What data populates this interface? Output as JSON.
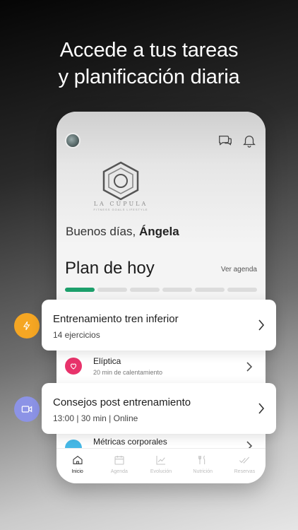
{
  "headline": {
    "line1": "Accede a tus tareas",
    "line2": "y planificación diaria"
  },
  "app": {
    "brand": {
      "name": "LA CÚPULA",
      "tagline": "FITNESS GOALS LIFESTYLE"
    },
    "greeting": {
      "prefix": "Buenos días,",
      "name": "Ángela"
    },
    "plan": {
      "title": "Plan de hoy",
      "agenda_link": "Ver agenda",
      "progress": {
        "completed": 1,
        "total": 6
      }
    },
    "rows": [
      {
        "title": "Elíptica",
        "subtitle": "20 min de calentamiento",
        "icon": "heart-icon",
        "color": "#e8336b"
      },
      {
        "title": "Métricas corporales",
        "icon": "scale-icon",
        "color": "#46b8e6"
      }
    ],
    "nav": [
      {
        "label": "Inicio",
        "icon": "home-icon",
        "active": true
      },
      {
        "label": "Agenda",
        "icon": "calendar-icon",
        "active": false
      },
      {
        "label": "Evolución",
        "icon": "chart-icon",
        "active": false
      },
      {
        "label": "Nutrición",
        "icon": "utensils-icon",
        "active": false
      },
      {
        "label": "Reservas",
        "icon": "checks-icon",
        "active": false
      }
    ]
  },
  "cards": [
    {
      "title": "Entrenamiento tren inferior",
      "subtitle": "14 ejercicios",
      "badge_icon": "lightning-icon",
      "badge_color": "#f5a623"
    },
    {
      "title": "Consejos post entrenamiento",
      "subtitle": "13:00 | 30 min | Online",
      "badge_icon": "video-icon",
      "badge_color": "#8c93e6"
    }
  ],
  "colors": {
    "accent": "#1c9f6b",
    "background_top": "#050505",
    "background_bottom": "#e6e6e6"
  }
}
